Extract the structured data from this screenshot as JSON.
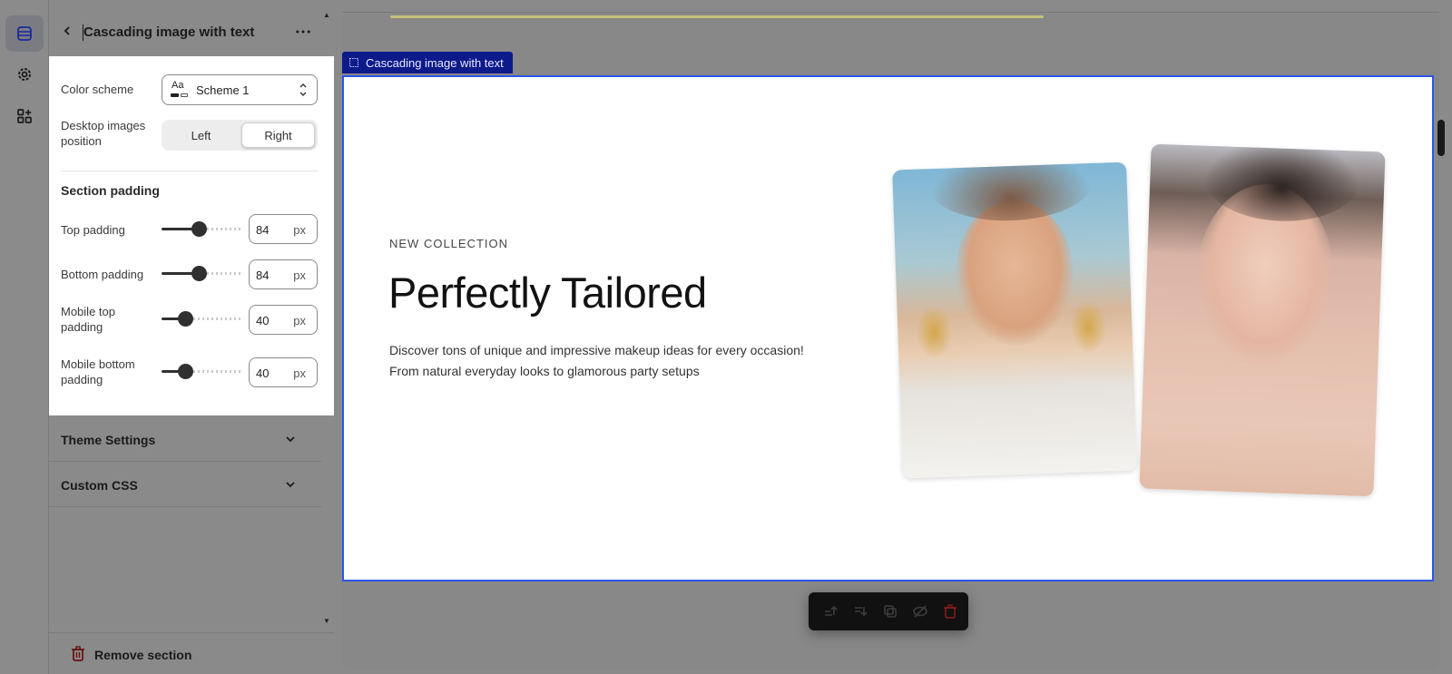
{
  "panel": {
    "title": "Cascading image with text",
    "color_scheme_label": "Color scheme",
    "color_scheme_value": "Scheme 1",
    "color_scheme_icon_text": "Aa",
    "images_position_label": "Desktop images position",
    "images_position_options": [
      "Left",
      "Right"
    ],
    "images_position_selected": "Right",
    "section_padding_heading": "Section padding",
    "sliders": [
      {
        "label": "Top padding",
        "value": "84",
        "unit": "px",
        "fraction": 0.45
      },
      {
        "label": "Bottom padding",
        "value": "84",
        "unit": "px",
        "fraction": 0.45
      },
      {
        "label": "Mobile top padding",
        "value": "40",
        "unit": "px",
        "fraction": 0.25
      },
      {
        "label": "Mobile bottom padding",
        "value": "40",
        "unit": "px",
        "fraction": 0.25
      }
    ],
    "accordions": [
      "Theme Settings",
      "Custom CSS"
    ],
    "remove_label": "Remove section"
  },
  "preview": {
    "section_tag": "Cascading image with text",
    "eyebrow": "NEW COLLECTION",
    "headline": "Perfectly Tailored",
    "description": "Discover tons of unique and impressive makeup ideas for every occasion! From natural everyday looks to glamorous party setups"
  },
  "icons": {
    "rail": [
      "sections-icon",
      "gear-icon",
      "apps-icon"
    ],
    "toolbar": [
      "move-up-icon",
      "move-down-icon",
      "duplicate-icon",
      "hide-icon",
      "delete-icon"
    ]
  },
  "colors": {
    "accent": "#2c56e8",
    "tag_bg": "#0d1a8a",
    "danger": "#e03030"
  }
}
